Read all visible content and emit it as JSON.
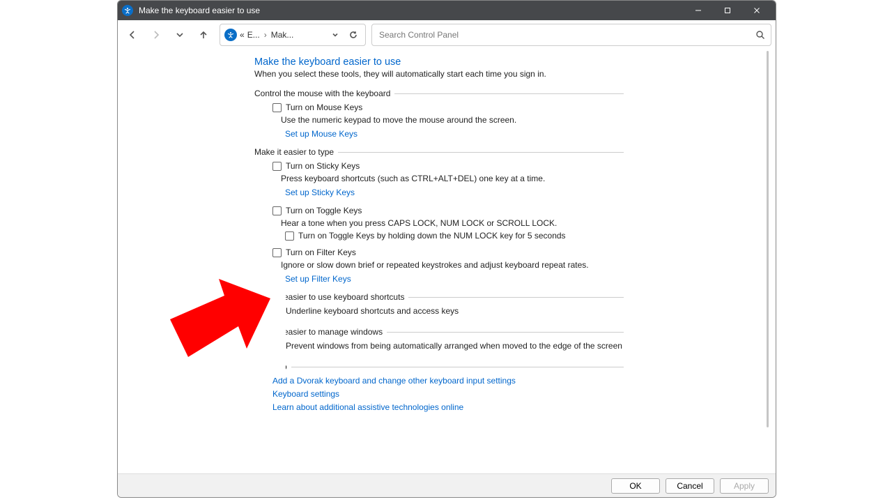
{
  "window": {
    "title": "Make the keyboard easier to use"
  },
  "breadcrumb": {
    "part1": "E...",
    "part2": "Mak..."
  },
  "search": {
    "placeholder": "Search Control Panel"
  },
  "page": {
    "title": "Make the keyboard easier to use",
    "subtitle": "When you select these tools, they will automatically start each time you sign in."
  },
  "sections": {
    "mouse": {
      "header": "Control the mouse with the keyboard",
      "mouseKeys": {
        "label": "Turn on Mouse Keys",
        "desc": "Use the numeric keypad to move the mouse around the screen.",
        "link": "Set up Mouse Keys"
      }
    },
    "type": {
      "header": "Make it easier to type",
      "sticky": {
        "label": "Turn on Sticky Keys",
        "desc": "Press keyboard shortcuts (such as CTRL+ALT+DEL) one key at a time.",
        "link": "Set up Sticky Keys"
      },
      "toggle": {
        "label": "Turn on Toggle Keys",
        "desc": "Hear a tone when you press CAPS LOCK, NUM LOCK or SCROLL LOCK.",
        "sub": "Turn on Toggle Keys by holding down the NUM LOCK key for 5 seconds"
      },
      "filter": {
        "label": "Turn on Filter Keys",
        "desc": "Ignore or slow down brief or repeated keystrokes and adjust keyboard repeat rates.",
        "link": "Set up Filter Keys"
      }
    },
    "shortcuts": {
      "header": "Make it easier to use keyboard shortcuts",
      "underline": "Underline keyboard shortcuts and access keys"
    },
    "windows": {
      "header": "Make it easier to manage windows",
      "prevent": "Prevent windows from being automatically arranged when moved to the edge of the screen"
    },
    "seealso": {
      "header": "See also",
      "link1": "Add a Dvorak keyboard and change other keyboard input settings",
      "link2": "Keyboard settings",
      "link3": "Learn about additional assistive technologies online"
    }
  },
  "footer": {
    "ok": "OK",
    "cancel": "Cancel",
    "apply": "Apply"
  }
}
